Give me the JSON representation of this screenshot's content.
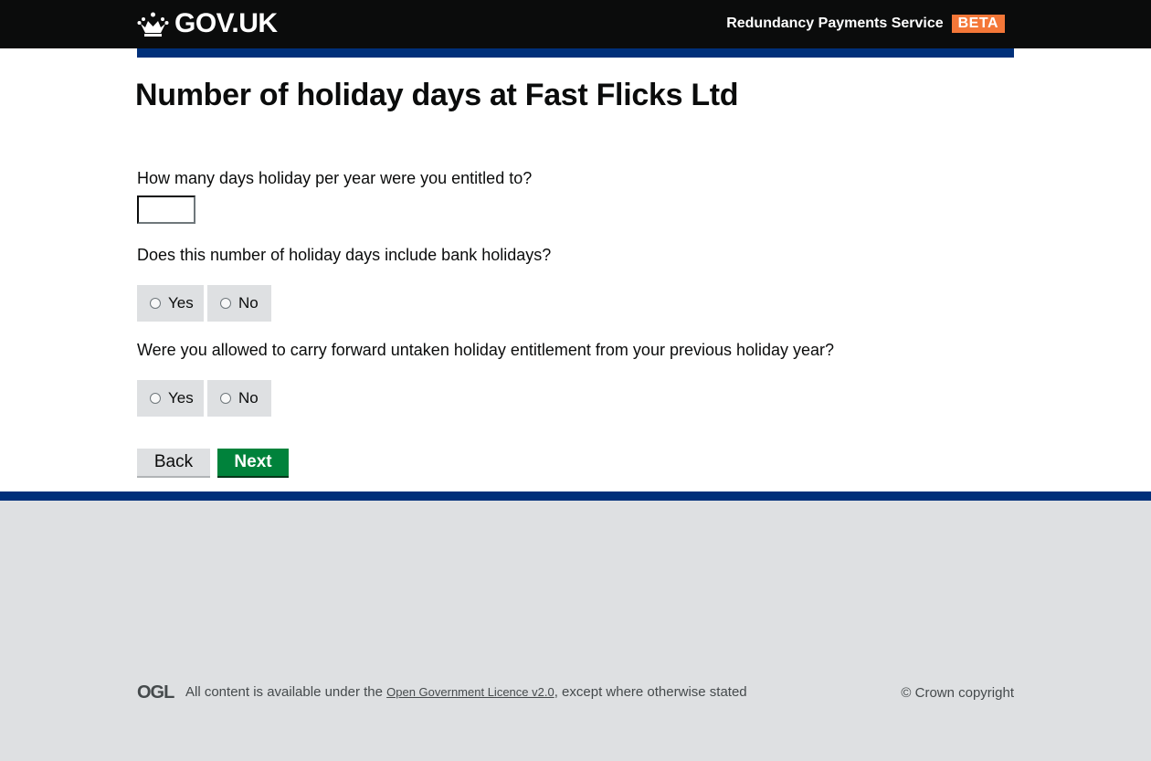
{
  "header": {
    "logo_text": "GOV.UK",
    "service_name": "Redundancy Payments Service",
    "phase_tag": "BETA"
  },
  "page": {
    "title": "Number of holiday days at Fast Flicks Ltd"
  },
  "form": {
    "q1_label": "How many days holiday per year were you entitled to?",
    "q1_value": "",
    "q2_label": "Does this number of holiday days include bank holidays?",
    "q2_yes": "Yes",
    "q2_no": "No",
    "q3_label": "Were you allowed to carry forward untaken holiday entitlement from your previous holiday year?",
    "q3_yes": "Yes",
    "q3_no": "No",
    "back_label": "Back",
    "next_label": "Next"
  },
  "footer": {
    "ogl_logo": "OGL",
    "licence_prefix": "All content is available under the ",
    "licence_link": "Open Government Licence v2.0",
    "licence_suffix": ", except where otherwise stated",
    "copyright": "© Crown copyright"
  },
  "colors": {
    "header_bg": "#0b0c0c",
    "phase_tag": "#f47738",
    "brand_bar": "#00307a",
    "next_button": "#00823b",
    "footer_bg": "#dee0e2"
  }
}
